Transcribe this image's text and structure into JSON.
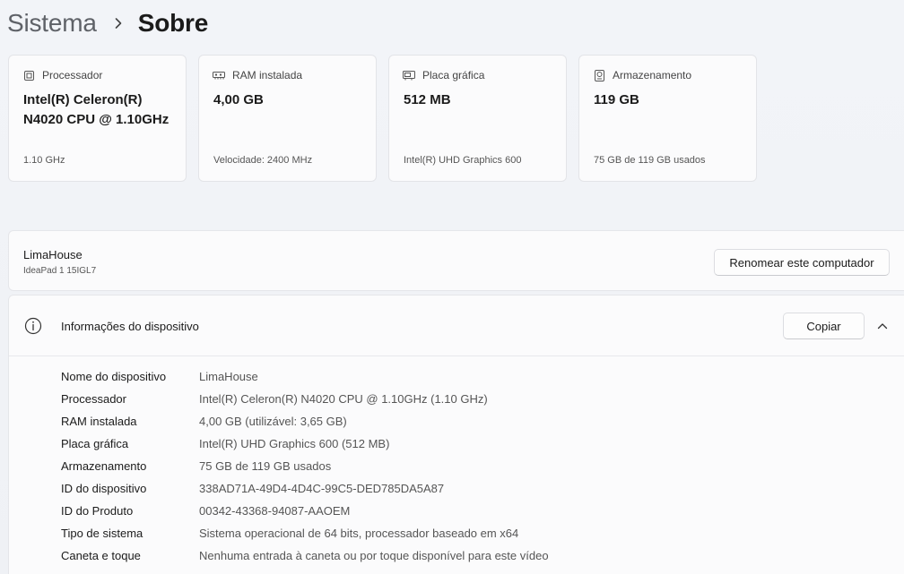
{
  "breadcrumb": {
    "parent": "Sistema",
    "current": "Sobre"
  },
  "spec_cards": [
    {
      "icon": "processor-icon",
      "label": "Processador",
      "value": "Intel(R) Celeron(R) N4020 CPU @ 1.10GHz",
      "detail": "1.10 GHz"
    },
    {
      "icon": "ram-icon",
      "label": "RAM instalada",
      "value": "4,00 GB",
      "detail": "Velocidade: 2400 MHz"
    },
    {
      "icon": "graphics-card-icon",
      "label": "Placa gráfica",
      "value": "512 MB",
      "detail": "Intel(R) UHD Graphics 600"
    },
    {
      "icon": "storage-icon",
      "label": "Armazenamento",
      "value": "119 GB",
      "detail": "75 GB de 119 GB usados"
    }
  ],
  "device": {
    "name": "LimaHouse",
    "model": "IdeaPad 1 15IGL7",
    "rename_label": "Renomear este computador"
  },
  "info_panel": {
    "title": "Informações do dispositivo",
    "copy_label": "Copiar",
    "rows": [
      {
        "key": "Nome do dispositivo",
        "value": "LimaHouse"
      },
      {
        "key": "Processador",
        "value": "Intel(R) Celeron(R) N4020 CPU @ 1.10GHz (1.10 GHz)"
      },
      {
        "key": "RAM instalada",
        "value": "4,00 GB (utilizável: 3,65 GB)"
      },
      {
        "key": "Placa gráfica",
        "value": "Intel(R) UHD Graphics 600 (512 MB)"
      },
      {
        "key": "Armazenamento",
        "value": "75 GB de 119 GB usados"
      },
      {
        "key": "ID do dispositivo",
        "value": "338AD71A-49D4-4D4C-99C5-DED785DA5A87"
      },
      {
        "key": "ID do Produto",
        "value": "00342-43368-94087-AAOEM"
      },
      {
        "key": "Tipo de sistema",
        "value": "Sistema operacional de 64 bits, processador baseado em x64"
      },
      {
        "key": "Caneta e toque",
        "value": "Nenhuma entrada à caneta ou por toque disponível para este vídeo"
      }
    ]
  }
}
